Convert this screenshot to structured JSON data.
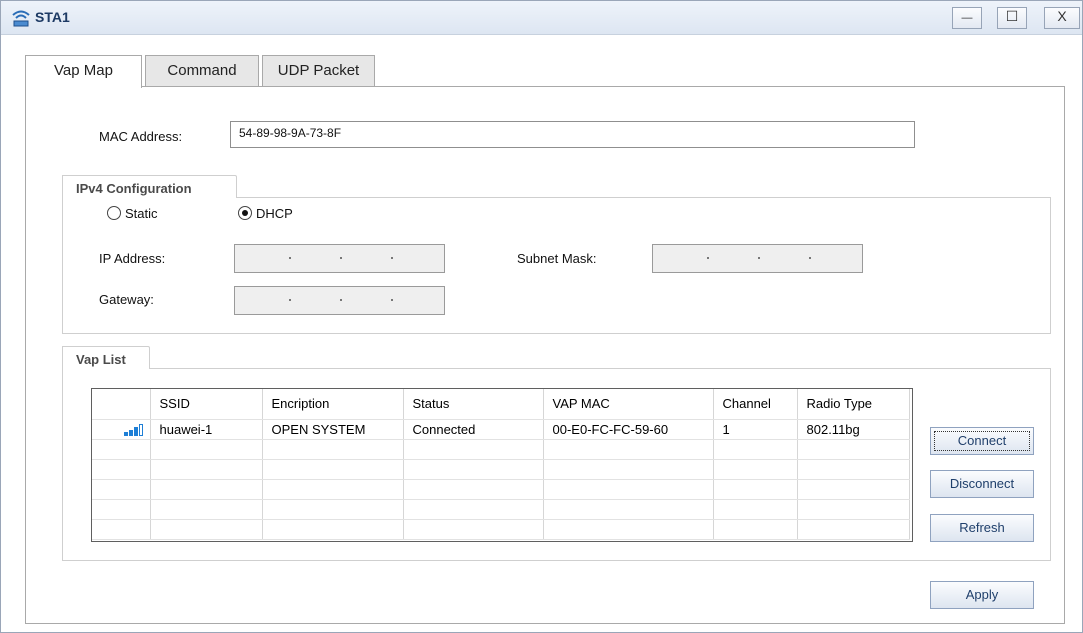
{
  "window": {
    "title": "STA1",
    "minimize_glyph": "—",
    "maximize_glyph": "☐",
    "close_glyph": "X"
  },
  "tabs": [
    {
      "label": "Vap Map",
      "active": true
    },
    {
      "label": "Command",
      "active": false
    },
    {
      "label": "UDP Packet",
      "active": false
    }
  ],
  "mac": {
    "label": "MAC Address:",
    "value": "54-89-98-9A-73-8F"
  },
  "ipv4": {
    "group_title": "IPv4 Configuration",
    "static_label": "Static",
    "dhcp_label": "DHCP",
    "selected": "DHCP",
    "ip_label": "IP Address:",
    "subnet_label": "Subnet Mask:",
    "gateway_label": "Gateway:"
  },
  "vap_list": {
    "group_title": "Vap List",
    "columns": [
      "SSID",
      "Encription",
      "Status",
      "VAP MAC",
      "Channel",
      "Radio Type"
    ],
    "rows": [
      {
        "ssid": "huawei-1",
        "encryption": "OPEN SYSTEM",
        "status": "Connected",
        "vap_mac": "00-E0-FC-FC-59-60",
        "channel": "1",
        "radio_type": "802.11bg",
        "signal": "signal-strength-icon"
      }
    ]
  },
  "buttons": {
    "connect": "Connect",
    "disconnect": "Disconnect",
    "refresh": "Refresh",
    "apply": "Apply"
  },
  "colors": {
    "title_text": "#1d3a64",
    "signal": "#1e7fd6",
    "button_text": "#1f3f6b"
  }
}
